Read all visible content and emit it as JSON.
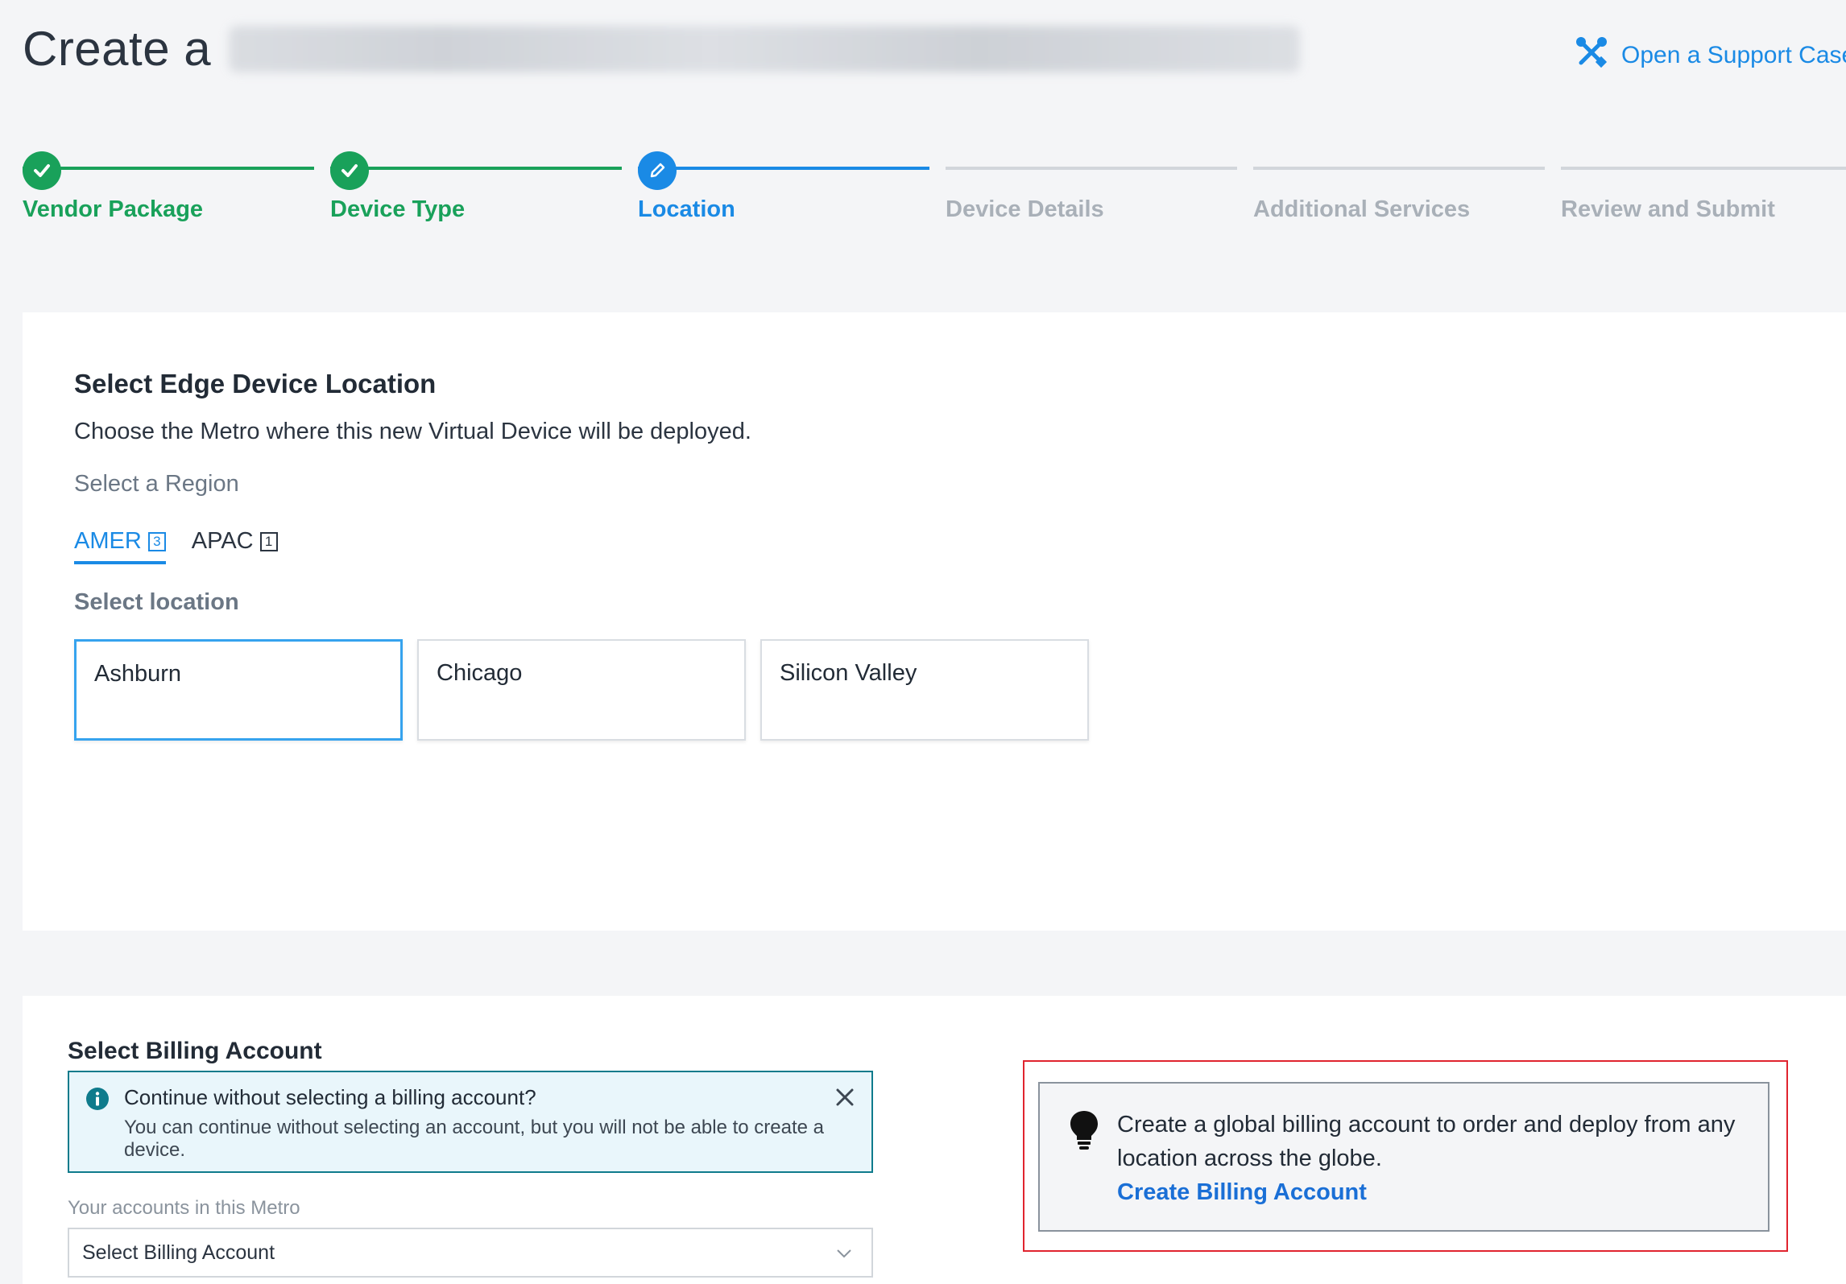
{
  "header": {
    "title_prefix": "Create a",
    "support_link": "Open a Support Case"
  },
  "stepper": {
    "steps": [
      {
        "label": "Vendor Package",
        "state": "done"
      },
      {
        "label": "Device Type",
        "state": "done"
      },
      {
        "label": "Location",
        "state": "active"
      },
      {
        "label": "Device Details",
        "state": "pending"
      },
      {
        "label": "Additional Services",
        "state": "pending"
      },
      {
        "label": "Review and Submit",
        "state": "pending"
      }
    ]
  },
  "location": {
    "title": "Select Edge Device Location",
    "description": "Choose the Metro where this new Virtual Device will be deployed.",
    "region_label": "Select a Region",
    "tabs": [
      {
        "label": "AMER",
        "count": "3"
      },
      {
        "label": "APAC",
        "count": "1"
      }
    ],
    "location_label": "Select location",
    "locations": [
      "Ashburn",
      "Chicago",
      "Silicon Valley"
    ]
  },
  "billing": {
    "title": "Select Billing Account",
    "alert_title": "Continue without selecting a billing account?",
    "alert_body": "You can continue without selecting an account, but you will not be able to create a device.",
    "accounts_label": "Your accounts in this Metro",
    "select_placeholder": "Select Billing Account",
    "tip_text": "Create a global billing account to order and deploy from any location across the globe.",
    "tip_link": "Create Billing Account"
  },
  "colors": {
    "success": "#19a15a",
    "accent": "#1a8ae5",
    "highlight": "#e0242f"
  }
}
